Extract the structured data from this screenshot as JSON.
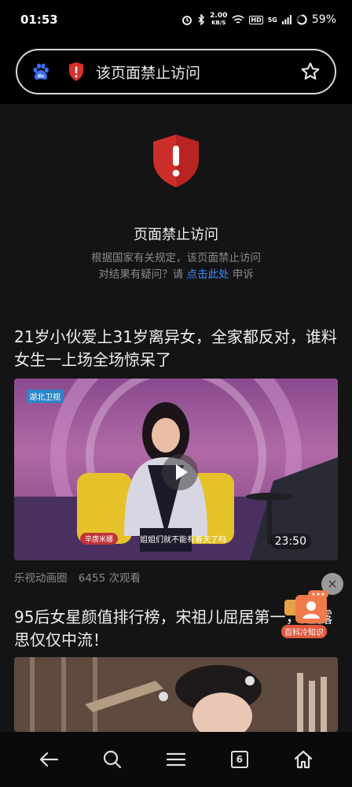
{
  "status": {
    "time": "01:53",
    "speed_value": "2.00",
    "speed_unit": "KB/S",
    "hd": "HD",
    "network": "5G",
    "battery": "59%"
  },
  "address_bar": {
    "title": "该页面禁止访问"
  },
  "forbidden": {
    "title": "页面禁止访问",
    "desc_line1": "根据国家有关规定，该页面禁止访问",
    "desc_line2_prefix": "对结果有疑问？请 ",
    "desc_link": "点击此处",
    "desc_line2_suffix": " 申诉"
  },
  "feed": [
    {
      "title": "21岁小伙爱上31岁离异女，全家都反对，谁料女生一上场全场惊呆了",
      "duration": "23:50",
      "channel_logo": "湖北卫视",
      "name_tag": "辛唐米娜",
      "subtitle": "姐姐们就不能有春天了吗",
      "source": "乐视动画圈",
      "views": "6455 次观看"
    },
    {
      "title": "95后女星颜值排行榜，宋祖儿屈居第一，赵露思仅仅中流！"
    }
  ],
  "floating_widget": {
    "close": "×",
    "label": "百科冷知识"
  },
  "bottom_nav": {
    "tab_count": "6"
  }
}
